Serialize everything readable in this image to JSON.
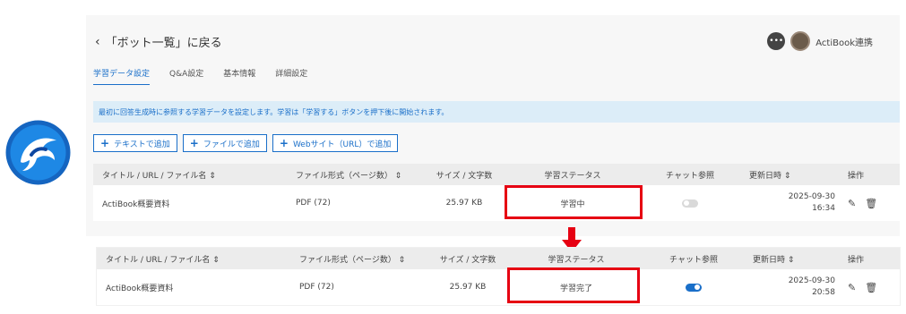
{
  "header": {
    "back_label": "「ボット一覧」に戻る",
    "user_name": "ActiBook連携"
  },
  "tabs": [
    {
      "label": "学習データ設定",
      "active": true
    },
    {
      "label": "Q&A設定",
      "active": false
    },
    {
      "label": "基本情報",
      "active": false
    },
    {
      "label": "詳細設定",
      "active": false
    }
  ],
  "notice": "最初に回答生成時に参照する学習データを設定します。学習は「学習する」ボタンを押下後に開始されます。",
  "buttons": {
    "add_text": "テキストで追加",
    "add_file": "ファイルで追加",
    "add_web": "Webサイト（URL）で追加"
  },
  "table_headers": {
    "title": "タイトル / URL / ファイル名 ⇕",
    "format": "ファイル形式（ページ数） ⇕",
    "size": "サイズ / 文字数",
    "status": "学習ステータス",
    "chat": "チャット参照",
    "updated": "更新日時 ⇕",
    "actions": "操作"
  },
  "before_row": {
    "title": "ActiBook概要資料",
    "format": "PDF (72)",
    "size": "25.97 KB",
    "status": "学習中",
    "chat_ref": false,
    "date": "2025-09-30",
    "time": "16:34"
  },
  "after_row": {
    "title": "ActiBook概要資料",
    "format": "PDF (72)",
    "size": "25.97 KB",
    "status": "学習完了",
    "chat_ref": true,
    "date": "2025-09-30",
    "time": "20:58"
  },
  "colors": {
    "accent": "#1a6fc9",
    "highlight": "#e60012",
    "notice_bg": "#dcedf8"
  },
  "icons": [
    "dolphin-logo-icon",
    "chat-bubble-icon",
    "pencil-icon",
    "trash-icon",
    "down-arrow-icon"
  ]
}
